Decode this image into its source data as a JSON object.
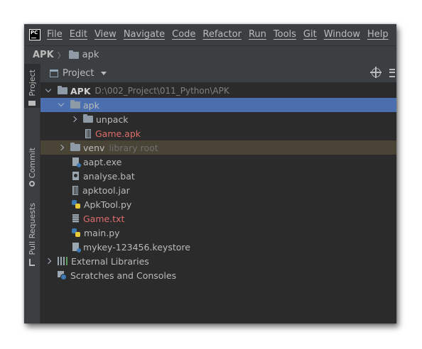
{
  "app": {
    "logo_text": "PC",
    "menu": [
      "File",
      "Edit",
      "View",
      "Navigate",
      "Code",
      "Refactor",
      "Run",
      "Tools",
      "Git",
      "Window",
      "Help"
    ]
  },
  "breadcrumb": {
    "root": "APK",
    "child": "apk"
  },
  "sidebar": {
    "tabs": [
      {
        "label": "Project",
        "icon": "folder-icon",
        "active": true
      },
      {
        "label": "Commit",
        "icon": "commit-icon",
        "active": false
      },
      {
        "label": "Pull Requests",
        "icon": "pull-request-icon",
        "active": false
      }
    ]
  },
  "panel": {
    "view_selector": "Project"
  },
  "tree": {
    "root_label": "APK",
    "root_path": "D:\\002_Project\\011_Python\\APK",
    "apk_folder": "apk",
    "unpack_folder": "unpack",
    "game_apk": "Game.apk",
    "venv_folder": "venv",
    "venv_hint": "library root",
    "aapt": "aapt.exe",
    "analyse": "analyse.bat",
    "apktool_jar": "apktool.jar",
    "apktool_py": "ApkTool.py",
    "game_txt": "Game.txt",
    "main_py": "main.py",
    "keystore": "mykey-123456.keystore",
    "external_libs": "External Libraries",
    "scratches": "Scratches and Consoles"
  },
  "colors": {
    "selection": "#4b6eaf",
    "excluded_row": "#4a4437",
    "untracked_file": "#e06c6c",
    "background": "#2b2b2b"
  }
}
